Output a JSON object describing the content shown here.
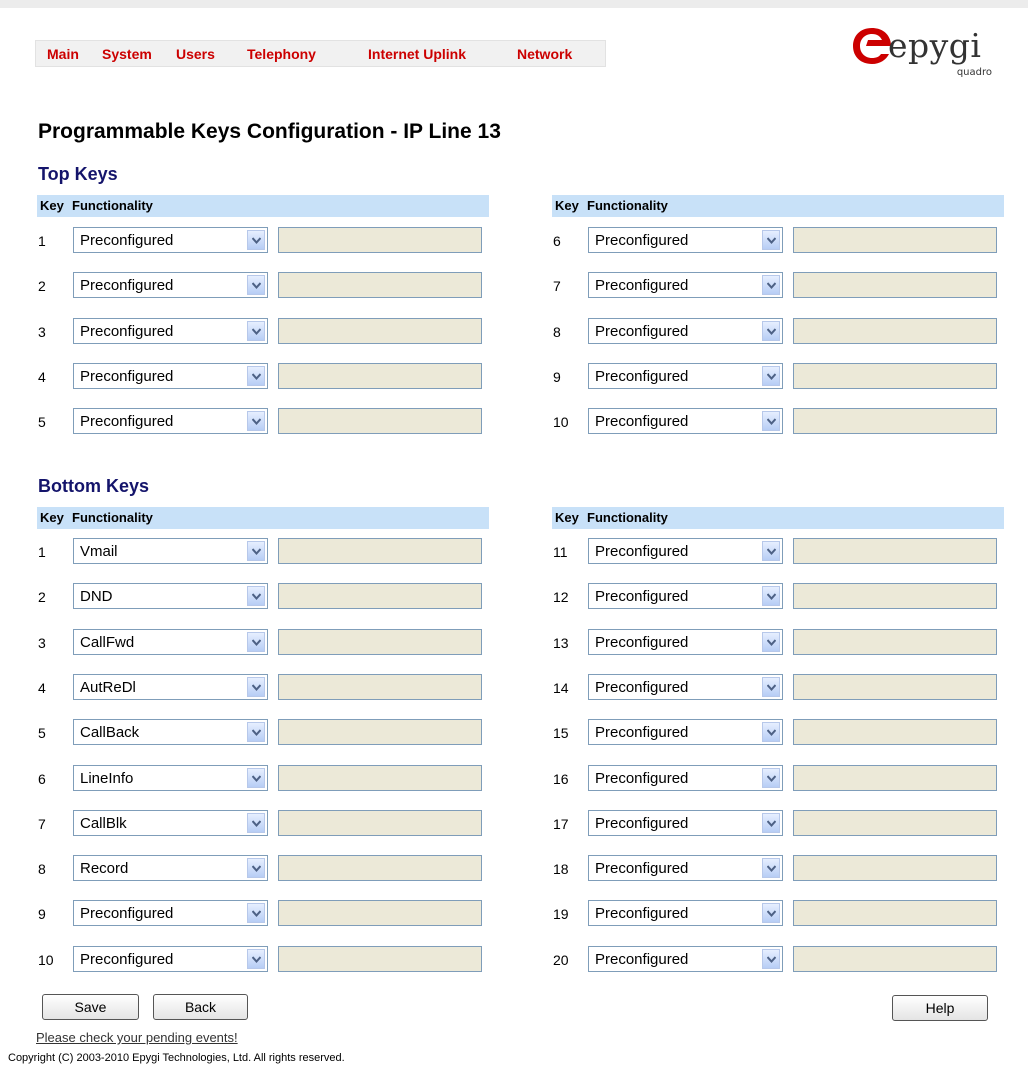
{
  "nav": {
    "items": [
      "Main",
      "System",
      "Users",
      "Telephony",
      "Internet Uplink",
      "Network"
    ]
  },
  "logo": {
    "text": "epygi",
    "sub": "quadro",
    "brand_color": "#cc0000"
  },
  "page_title": "Programmable Keys Configuration - IP Line 13",
  "headers": {
    "key": "Key",
    "functionality": "Functionality"
  },
  "top_keys": {
    "title": "Top Keys",
    "left": [
      {
        "key": "1",
        "value": "Preconfigured",
        "text": ""
      },
      {
        "key": "2",
        "value": "Preconfigured",
        "text": ""
      },
      {
        "key": "3",
        "value": "Preconfigured",
        "text": ""
      },
      {
        "key": "4",
        "value": "Preconfigured",
        "text": ""
      },
      {
        "key": "5",
        "value": "Preconfigured",
        "text": ""
      }
    ],
    "right": [
      {
        "key": "6",
        "value": "Preconfigured",
        "text": ""
      },
      {
        "key": "7",
        "value": "Preconfigured",
        "text": ""
      },
      {
        "key": "8",
        "value": "Preconfigured",
        "text": ""
      },
      {
        "key": "9",
        "value": "Preconfigured",
        "text": ""
      },
      {
        "key": "10",
        "value": "Preconfigured",
        "text": ""
      }
    ]
  },
  "bottom_keys": {
    "title": "Bottom Keys",
    "left": [
      {
        "key": "1",
        "value": "Vmail",
        "text": ""
      },
      {
        "key": "2",
        "value": "DND",
        "text": ""
      },
      {
        "key": "3",
        "value": "CallFwd",
        "text": ""
      },
      {
        "key": "4",
        "value": "AutReDl",
        "text": ""
      },
      {
        "key": "5",
        "value": "CallBack",
        "text": ""
      },
      {
        "key": "6",
        "value": "LineInfo",
        "text": ""
      },
      {
        "key": "7",
        "value": "CallBlk",
        "text": ""
      },
      {
        "key": "8",
        "value": "Record",
        "text": ""
      },
      {
        "key": "9",
        "value": "Preconfigured",
        "text": ""
      },
      {
        "key": "10",
        "value": "Preconfigured",
        "text": ""
      }
    ],
    "right": [
      {
        "key": "11",
        "value": "Preconfigured",
        "text": ""
      },
      {
        "key": "12",
        "value": "Preconfigured",
        "text": ""
      },
      {
        "key": "13",
        "value": "Preconfigured",
        "text": ""
      },
      {
        "key": "14",
        "value": "Preconfigured",
        "text": ""
      },
      {
        "key": "15",
        "value": "Preconfigured",
        "text": ""
      },
      {
        "key": "16",
        "value": "Preconfigured",
        "text": ""
      },
      {
        "key": "17",
        "value": "Preconfigured",
        "text": ""
      },
      {
        "key": "18",
        "value": "Preconfigured",
        "text": ""
      },
      {
        "key": "19",
        "value": "Preconfigured",
        "text": ""
      },
      {
        "key": "20",
        "value": "Preconfigured",
        "text": ""
      }
    ]
  },
  "buttons": {
    "save": "Save",
    "back": "Back",
    "help": "Help"
  },
  "pending_link": "Please check your pending events!",
  "copyright": "Copyright (C) 2003-2010 Epygi Technologies, Ltd. All rights reserved."
}
